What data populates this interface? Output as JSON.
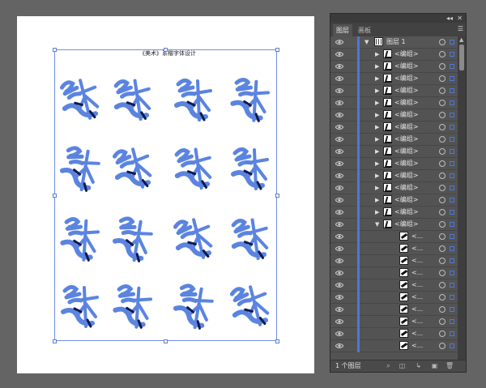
{
  "artboard": {
    "title": "《美术》系楷字体设计",
    "accent_color": "#5b84e0",
    "glyph_color": "#5b84e0",
    "ink_color": "#0d1a4d",
    "glyph_grid": {
      "rows": 4,
      "cols": 4
    }
  },
  "panel": {
    "tabs": [
      {
        "label": "图层"
      },
      {
        "label": "画板"
      }
    ],
    "layer": {
      "name": "图层 1"
    },
    "groups": [
      {
        "label": "<编组>"
      },
      {
        "label": "<编组>"
      },
      {
        "label": "<编组>"
      },
      {
        "label": "<编组>"
      },
      {
        "label": "<编组>"
      },
      {
        "label": "<编组>"
      },
      {
        "label": "<编组>"
      },
      {
        "label": "<编组>"
      },
      {
        "label": "<编组>"
      },
      {
        "label": "<编组>"
      },
      {
        "label": "<编组>"
      },
      {
        "label": "<编组>"
      },
      {
        "label": "<编组>"
      },
      {
        "label": "<编组>"
      },
      {
        "label": "<编组>"
      }
    ],
    "paths": [
      {
        "label": "<..."
      },
      {
        "label": "<..."
      },
      {
        "label": "<..."
      },
      {
        "label": "<..."
      },
      {
        "label": "<..."
      },
      {
        "label": "<..."
      },
      {
        "label": "<..."
      },
      {
        "label": "<..."
      },
      {
        "label": "<..."
      },
      {
        "label": "<..."
      }
    ],
    "footer": {
      "label": "1 个图层"
    },
    "icons": [
      "collapse-icon",
      "close-icon",
      "menu-icon",
      "eye-icon",
      "target-icon",
      "search-icon",
      "make-clip-icon",
      "new-sublayer-icon",
      "new-layer-icon",
      "trash-icon"
    ]
  }
}
